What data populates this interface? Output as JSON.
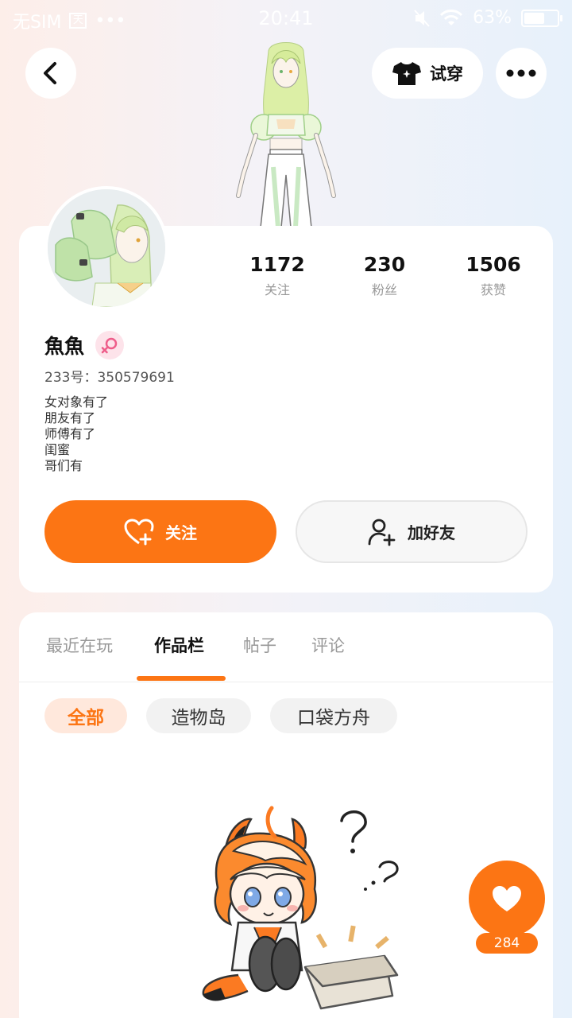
{
  "status_bar": {
    "carrier": "无SIM",
    "sim_icon_text": "天",
    "time": "20:41",
    "battery_text": "63%",
    "battery_level": 0.63
  },
  "header": {
    "try_on_label": "试穿"
  },
  "profile": {
    "stats": [
      {
        "value": "1172",
        "label": "关注"
      },
      {
        "value": "230",
        "label": "粉丝"
      },
      {
        "value": "1506",
        "label": "获赞"
      }
    ],
    "nickname": "魚魚",
    "gender": "female",
    "uid": "233号：350579691",
    "bio_lines": [
      "女对象有了",
      "朋友有了",
      "师傅有了",
      "闺蜜",
      "哥们有"
    ],
    "follow_label": "关注",
    "add_friend_label": "加好友"
  },
  "content": {
    "tabs": [
      "最近在玩",
      "作品栏",
      "帖子",
      "评论"
    ],
    "active_tab": 1,
    "chips": [
      "全部",
      "造物岛",
      "口袋方舟"
    ],
    "active_chip": 0
  },
  "floating_like": {
    "count": "284"
  },
  "colors": {
    "accent": "#fc7514",
    "accent_light": "#ffe8dc",
    "gender_badge": "#fde3ea",
    "gender_symbol": "#ee5d8a"
  },
  "icons": {
    "back": "chevron-left-icon",
    "try_on": "tshirt-icon",
    "more": "more-dots-icon",
    "gender": "female-icon",
    "follow": "heart-plus-icon",
    "add_friend": "user-plus-icon",
    "like": "heart-icon"
  }
}
